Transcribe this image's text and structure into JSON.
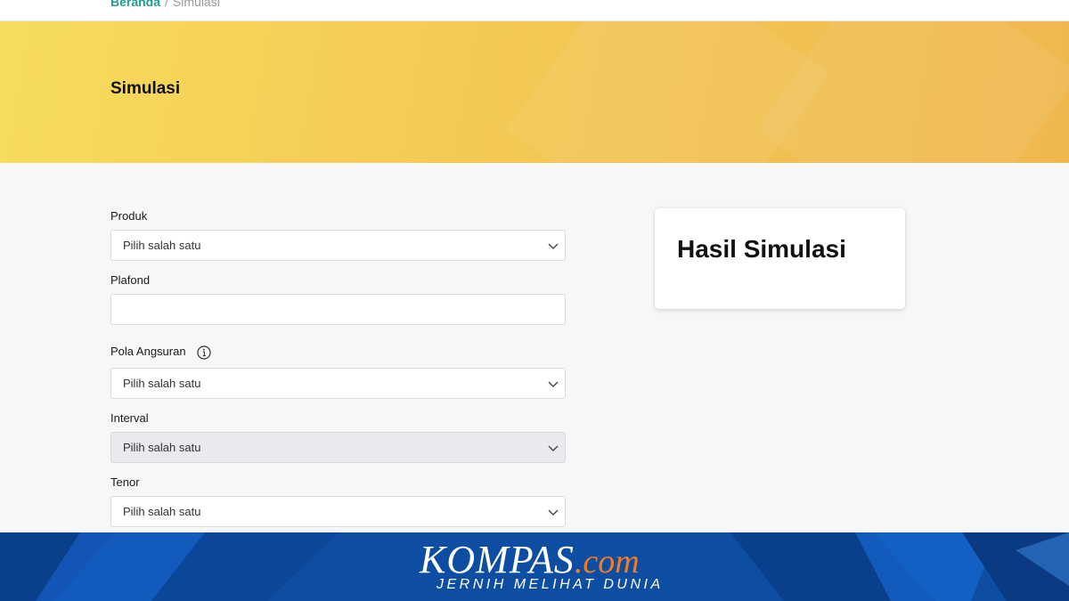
{
  "breadcrumb": {
    "home": "Beranda",
    "separator": "/",
    "current": "Simulasi"
  },
  "hero": {
    "title": "Simulasi"
  },
  "form": {
    "produk": {
      "label": "Produk",
      "value": "Pilih salah satu"
    },
    "plafond": {
      "label": "Plafond",
      "value": ""
    },
    "pola_angsuran": {
      "label": "Pola Angsuran",
      "value": "Pilih salah satu"
    },
    "interval": {
      "label": "Interval",
      "value": "Pilih salah satu",
      "disabled": true
    },
    "tenor": {
      "label": "Tenor",
      "value": "Pilih salah satu"
    }
  },
  "result": {
    "title": "Hasil Simulasi"
  },
  "banner": {
    "brand": "KOMPAS",
    "brand_suffix": ".com",
    "tagline": "JERNIH MELIHAT DUNIA"
  },
  "colors": {
    "breadcrumb_link": "#1f9d8f",
    "hero_start": "#f7dc5c",
    "hero_end": "#efb84f",
    "banner_bg": "#0d4ea3",
    "brand_accent": "#f47c20"
  },
  "icons": {
    "select_arrow": "chevron-down-icon",
    "info": "info-icon"
  }
}
